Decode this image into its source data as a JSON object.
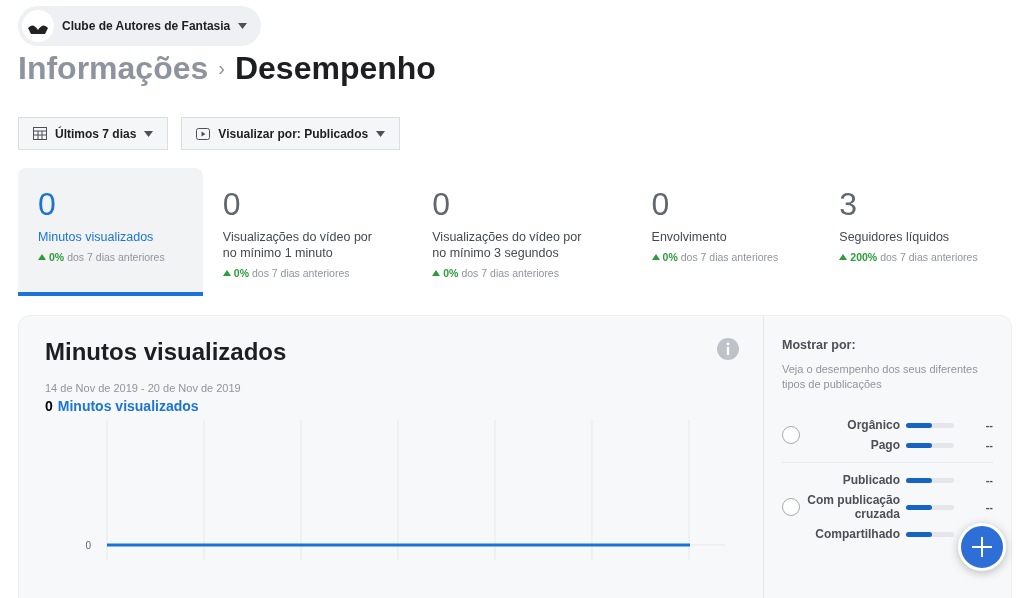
{
  "page_selector": {
    "name": "Clube de Autores de Fantasia"
  },
  "breadcrumb": {
    "parent": "Informações",
    "separator": "›",
    "current": "Desempenho"
  },
  "filters": [
    {
      "kind": "calendar",
      "label": "Últimos 7 dias"
    },
    {
      "kind": "video",
      "label": "Visualizar por: Publicados"
    }
  ],
  "metrics": [
    {
      "value": "0",
      "label": "Minutos visualizados",
      "change": "0%",
      "comparison": "dos 7 dias anteriores",
      "selected": true
    },
    {
      "value": "0",
      "label": "Visualizações do vídeo por no mínimo 1 minuto",
      "change": "0%",
      "comparison": "dos 7 dias anteriores",
      "selected": false
    },
    {
      "value": "0",
      "label": "Visualizações do vídeo por no mínimo 3 segundos",
      "change": "0%",
      "comparison": "dos 7 dias anteriores",
      "selected": false
    },
    {
      "value": "0",
      "label": "Envolvimento",
      "change": "0%",
      "comparison": "dos 7 dias anteriores",
      "selected": false
    },
    {
      "value": "3",
      "label": "Seguidores líquidos",
      "change": "200%",
      "comparison": "dos 7 dias anteriores",
      "selected": false
    }
  ],
  "chart_card": {
    "title": "Minutos visualizados",
    "date_range": "14 de Nov de 2019 - 20 de Nov de 2019",
    "total": "0",
    "total_label": "Minutos visualizados",
    "axis_label": "0"
  },
  "show_by": {
    "title": "Mostrar por:",
    "description": "Veja o desempenho dos seus diferentes tipos de publicações",
    "groups": [
      {
        "selected": false,
        "rows": [
          {
            "label": "Orgânico",
            "level": 0.55,
            "value": "--"
          },
          {
            "label": "Pago",
            "level": 0.55,
            "value": "--"
          }
        ]
      },
      {
        "selected": false,
        "rows": [
          {
            "label": "Publicado",
            "level": 0.55,
            "value": "--"
          },
          {
            "label": "Com publicação cruzada",
            "level": 0.55,
            "value": "--"
          },
          {
            "label": "Compartilhado",
            "level": 0.55
          }
        ]
      }
    ]
  }
}
